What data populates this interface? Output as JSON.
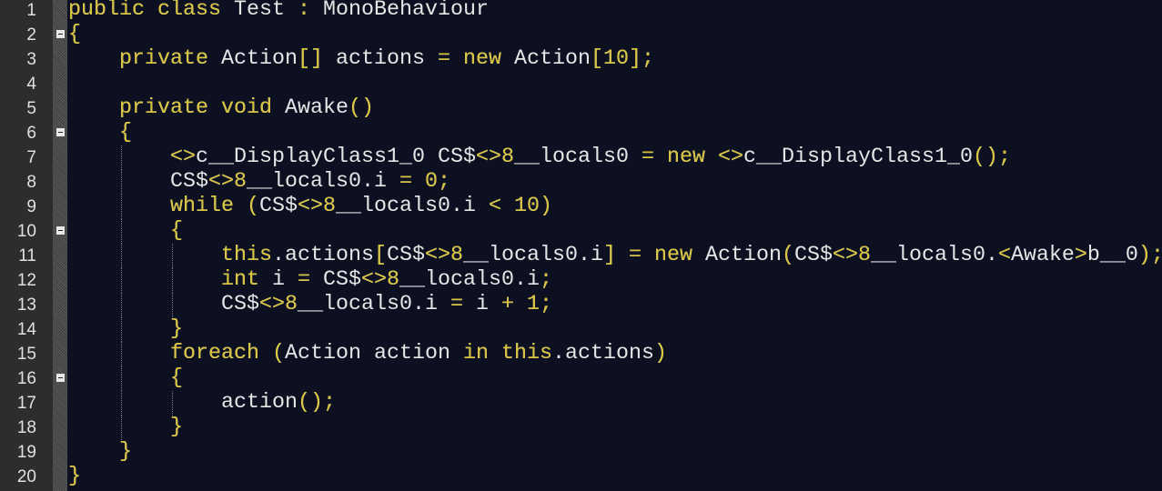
{
  "editor": {
    "language": "C#",
    "colors": {
      "background": "#0c1020",
      "keyword": "#d8c43f",
      "identifier": "#e6e6e6",
      "gutter": "#2b2d2f"
    },
    "fold_lines": [
      2,
      6,
      10,
      16
    ],
    "lines": [
      "public class Test : MonoBehaviour",
      "{",
      "    private Action[] actions = new Action[10];",
      "",
      "    private void Awake()",
      "    {",
      "        <>c__DisplayClass1_0 CS$<>8__locals0 = new <>c__DisplayClass1_0();",
      "        CS$<>8__locals0.i = 0;",
      "        while (CS$<>8__locals0.i < 10)",
      "        {",
      "            this.actions[CS$<>8__locals0.i] = new Action(CS$<>8__locals0.<Awake>b__0);",
      "            int i = CS$<>8__locals0.i;",
      "            CS$<>8__locals0.i = i + 1;",
      "        }",
      "        foreach (Action action in this.actions)",
      "        {",
      "            action();",
      "        }",
      "    }",
      "}"
    ]
  }
}
